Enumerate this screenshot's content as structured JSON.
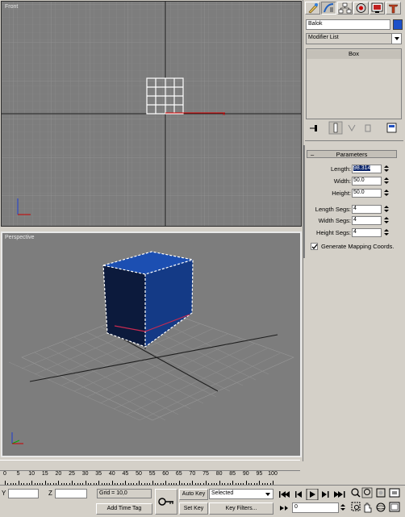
{
  "viewports": {
    "front_label": "Front",
    "perspective_label": "Perspective"
  },
  "command_panel": {
    "tabs": [
      "create-icon",
      "modify-icon",
      "hierarchy-icon",
      "motion-icon",
      "display-icon",
      "utilities-icon"
    ],
    "object_name": "Balok",
    "object_color": "#1c50c8",
    "modifier_list_label": "Modifier List",
    "stack_item": "Box"
  },
  "parameters": {
    "header": "Parameters",
    "length_label": "Length:",
    "length_value": "98.314",
    "width_label": "Width:",
    "width_value": "50.0",
    "height_label": "Height:",
    "height_value": "50.0",
    "length_segs_label": "Length Segs:",
    "length_segs_value": "4",
    "width_segs_label": "Width Segs:",
    "width_segs_value": "4",
    "height_segs_label": "Height Segs:",
    "height_segs_value": "4",
    "mapping_label": "Generate Mapping Coords."
  },
  "timeline": {
    "tick_labels": [
      "0",
      "5",
      "10",
      "15",
      "20",
      "25",
      "30",
      "35",
      "40",
      "45",
      "50",
      "55",
      "60",
      "65",
      "70",
      "75",
      "80",
      "85",
      "90",
      "95",
      "100"
    ]
  },
  "statusbar": {
    "y_label": "Y",
    "z_label": "Z",
    "grid_text": "Grid = 10,0",
    "add_time_tag": "Add Time Tag",
    "auto_key": "Auto Key",
    "selected_option": "Selected",
    "set_key": "Set Key",
    "key_filters": "Key Filters...",
    "frame_value": "0"
  }
}
